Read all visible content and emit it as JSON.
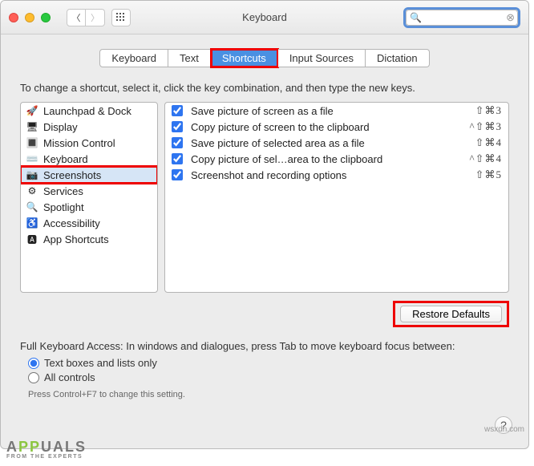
{
  "window": {
    "title": "Keyboard"
  },
  "search": {
    "placeholder": ""
  },
  "tabs": [
    {
      "label": "Keyboard",
      "active": false
    },
    {
      "label": "Text",
      "active": false
    },
    {
      "label": "Shortcuts",
      "active": true,
      "highlight": true
    },
    {
      "label": "Input Sources",
      "active": false
    },
    {
      "label": "Dictation",
      "active": false
    }
  ],
  "instruction": "To change a shortcut, select it, click the key combination, and then type the new keys.",
  "categories": [
    {
      "icon": "🚀",
      "label": "Launchpad & Dock"
    },
    {
      "icon": "🖥",
      "label": "Display"
    },
    {
      "icon": "🔳",
      "label": "Mission Control"
    },
    {
      "icon": "⌨️",
      "label": "Keyboard"
    },
    {
      "icon": "📷",
      "label": "Screenshots",
      "selected": true,
      "highlight": true
    },
    {
      "icon": "⚙",
      "label": "Services"
    },
    {
      "icon": "🔍",
      "label": "Spotlight"
    },
    {
      "icon": "♿",
      "label": "Accessibility"
    },
    {
      "icon": "🅰",
      "label": "App Shortcuts"
    }
  ],
  "shortcuts": [
    {
      "checked": true,
      "label": "Save picture of screen as a file",
      "keys": "⇧⌘3"
    },
    {
      "checked": true,
      "label": "Copy picture of screen to the clipboard",
      "keys": "^⇧⌘3"
    },
    {
      "checked": true,
      "label": "Save picture of selected area as a file",
      "keys": "⇧⌘4"
    },
    {
      "checked": true,
      "label": "Copy picture of sel…area to the clipboard",
      "keys": "^⇧⌘4"
    },
    {
      "checked": true,
      "label": "Screenshot and recording options",
      "keys": "⇧⌘5"
    }
  ],
  "restore": {
    "label": "Restore Defaults"
  },
  "fullKeyboardAccess": {
    "label": "Full Keyboard Access: In windows and dialogues, press Tab to move keyboard focus between:",
    "options": [
      {
        "checked": true,
        "label": "Text boxes and lists only"
      },
      {
        "checked": false,
        "label": "All controls"
      }
    ],
    "hint": "Press Control+F7 to change this setting."
  },
  "attribution": "wsxdn.com",
  "logo": {
    "text_pre": "A",
    "text_green": "PP",
    "text_post": "UALS",
    "sub": "FROM THE EXPERTS"
  }
}
